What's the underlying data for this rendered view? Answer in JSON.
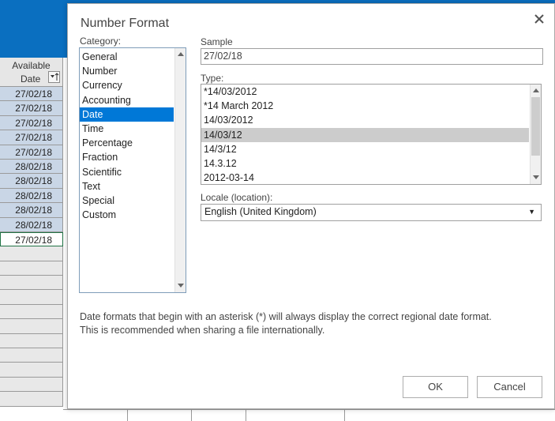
{
  "sheet": {
    "column_header": {
      "line1": "Available",
      "line2": "Date"
    },
    "cells": [
      {
        "value": "27/02/18",
        "state": "selected"
      },
      {
        "value": "27/02/18",
        "state": "selected"
      },
      {
        "value": "27/02/18",
        "state": "selected"
      },
      {
        "value": "27/02/18",
        "state": "selected"
      },
      {
        "value": "27/02/18",
        "state": "selected"
      },
      {
        "value": "28/02/18",
        "state": "selected"
      },
      {
        "value": "28/02/18",
        "state": "selected"
      },
      {
        "value": "28/02/18",
        "state": "selected"
      },
      {
        "value": "28/02/18",
        "state": "selected"
      },
      {
        "value": "28/02/18",
        "state": "selected"
      },
      {
        "value": "27/02/18",
        "state": "active"
      },
      {
        "value": "",
        "state": "empty"
      },
      {
        "value": "",
        "state": "empty"
      },
      {
        "value": "",
        "state": "empty"
      },
      {
        "value": "",
        "state": "empty"
      },
      {
        "value": "",
        "state": "empty"
      },
      {
        "value": "",
        "state": "empty"
      },
      {
        "value": "",
        "state": "empty"
      },
      {
        "value": "",
        "state": "empty"
      },
      {
        "value": "",
        "state": "empty"
      },
      {
        "value": "",
        "state": "empty"
      },
      {
        "value": "",
        "state": "empty"
      }
    ],
    "colors": {
      "ribbon": "#0a6fc0",
      "selection": "#c9d6e6",
      "active_border": "#217346"
    }
  },
  "dialog": {
    "title": "Number Format",
    "close_icon": "close-icon",
    "category": {
      "label": "Category:",
      "items": [
        "General",
        "Number",
        "Currency",
        "Accounting",
        "Date",
        "Time",
        "Percentage",
        "Fraction",
        "Scientific",
        "Text",
        "Special",
        "Custom"
      ],
      "selected": "Date"
    },
    "sample": {
      "label": "Sample",
      "value": "27/02/18"
    },
    "type": {
      "label": "Type:",
      "items": [
        "*14/03/2012",
        "*14 March 2012",
        "14/03/2012",
        "14/03/12",
        "14/3/12",
        "14.3.12",
        "2012-03-14"
      ],
      "selected": "14/03/12"
    },
    "locale": {
      "label": "Locale (location):",
      "value": "English (United Kingdom)"
    },
    "note_line1": "Date formats that begin with an asterisk (*) will always display the correct regional date format.",
    "note_line2": "This is recommended when sharing a file internationally.",
    "ok_label": "OK",
    "cancel_label": "Cancel",
    "colors": {
      "list_selection": "#0078d7",
      "type_selection": "#cccccc"
    }
  }
}
